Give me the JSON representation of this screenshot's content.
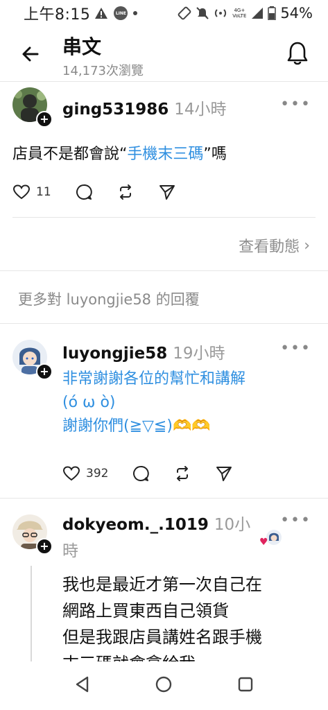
{
  "status_bar": {
    "time": "上午8:15",
    "battery": "54%",
    "line_badge": "LINE",
    "lte_badge": "4G+ VoLTE"
  },
  "header": {
    "title": "串文",
    "views": "14,173次瀏覽"
  },
  "post1": {
    "username": "ging531986",
    "time": "14小時",
    "text_before": "店員不是都會說“",
    "text_link": "手機末三碼",
    "text_after": "”嗎",
    "likes": "11"
  },
  "see_activity": {
    "label": "查看動態",
    "chevron": "›"
  },
  "more_replies_label": "更多對 luyongjie58 的回覆",
  "post2": {
    "username": "luyongjie58",
    "time": "19小時",
    "lines": [
      "非常謝謝各位的幫忙和講解",
      "(ó ω ò)",
      "謝謝你們(≧▽≦)🫶🫶"
    ],
    "likes": "392"
  },
  "post3": {
    "username": "dokyeom._.1019",
    "time_line1": "10小",
    "time_line2": "時",
    "lines": [
      "我也是最近才第一次自己在",
      "網路上買東西自己領貨",
      "但是我跟店員講姓名跟手機",
      "末三碼就會拿給我"
    ]
  },
  "common": {
    "more": "•••",
    "plus": "+"
  },
  "colors": {
    "link": "#2f8fe0",
    "muted": "#8a8a8a",
    "heart": "#e0245e"
  },
  "icons": [
    "back-arrow-icon",
    "bell-icon",
    "heart-icon",
    "comment-icon",
    "repost-icon",
    "share-icon",
    "plus-icon",
    "nav-back-icon",
    "nav-home-icon",
    "nav-recents-icon"
  ]
}
